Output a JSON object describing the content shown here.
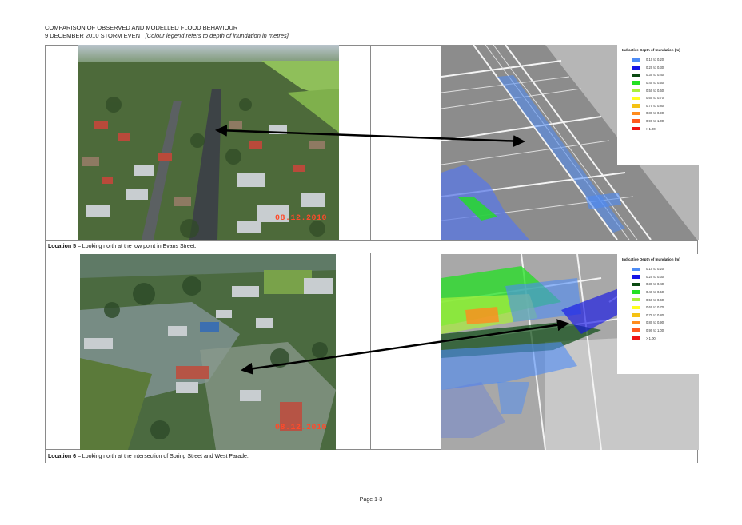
{
  "header": {
    "line1": "COMPARISON OF OBSERVED AND MODELLED FLOOD BEHAVIOUR",
    "line2_prefix": "9 DECEMBER 2010 STORM EVENT ",
    "line2_italic": "[Colour legend refers to depth of inundation in metres]"
  },
  "legend": {
    "title": "Indicative Depth of Inundation (m)",
    "items": [
      {
        "label": "0.10 to 0.20",
        "color": "#4c8bf5"
      },
      {
        "label": "0.20 to 0.30",
        "color": "#1414e6"
      },
      {
        "label": "0.30 to 0.40",
        "color": "#0b4a12"
      },
      {
        "label": "0.40 to 0.50",
        "color": "#22e022"
      },
      {
        "label": "0.50 to 0.60",
        "color": "#aaf03c"
      },
      {
        "label": "0.60 to 0.70",
        "color": "#ffff1e"
      },
      {
        "label": "0.70 to 0.80",
        "color": "#f5c214"
      },
      {
        "label": "0.80 to 0.90",
        "color": "#ff8c1e"
      },
      {
        "label": "0.90 to 1.00",
        "color": "#ff5a1e"
      },
      {
        "label": "> 1.00",
        "color": "#ee1414"
      }
    ]
  },
  "locations": [
    {
      "label": "Location 5",
      "desc": " – Looking north at the low point in Evans Street.",
      "date_stamp": "08.12.2010"
    },
    {
      "label": "Location 6",
      "desc": " – Looking north at the intersection of Spring Street and West Parade.",
      "date_stamp": "08.12.2010"
    }
  ],
  "footer": {
    "page": "Page 1-3"
  },
  "colors": {
    "arrow": "#000000",
    "stamp": "#ff4a2a"
  }
}
